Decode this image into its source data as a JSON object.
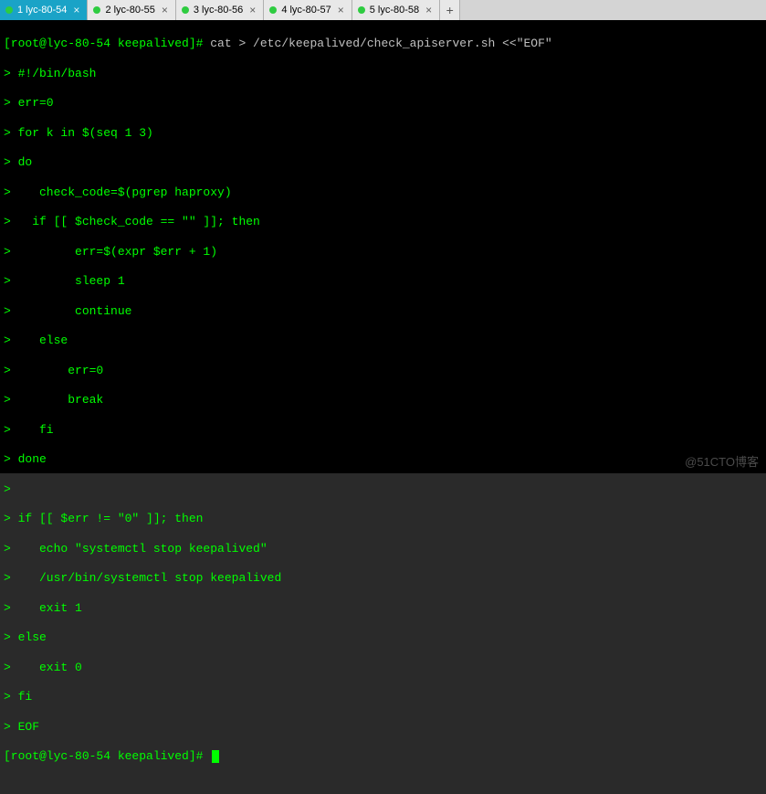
{
  "tabs": [
    {
      "label": "1 lyc-80-54",
      "active": true
    },
    {
      "label": "2 lyc-80-55",
      "active": false
    },
    {
      "label": "3 lyc-80-56",
      "active": false
    },
    {
      "label": "4 lyc-80-57",
      "active": false
    },
    {
      "label": "5 lyc-80-58",
      "active": false
    }
  ],
  "new_tab_label": "+",
  "prompt": {
    "user_host": "[root@lyc-80-54 keepalived]#",
    "command": "cat > /etc/keepalived/check_apiserver.sh <<\"EOF\""
  },
  "script_lines": [
    "> #!/bin/bash",
    "> err=0",
    "> for k in $(seq 1 3)",
    "> do",
    ">    check_code=$(pgrep haproxy)",
    ">   if [[ $check_code == \"\" ]]; then",
    ">         err=$(expr $err + 1)",
    ">         sleep 1",
    ">         continue",
    ">    else",
    ">        err=0",
    ">        break",
    ">    fi",
    "> done",
    ">",
    "> if [[ $err != \"0\" ]]; then",
    ">    echo \"systemctl stop keepalived\"",
    ">    /usr/bin/systemctl stop keepalived",
    ">    exit 1",
    "> else",
    ">    exit 0",
    "> fi",
    "> EOF"
  ],
  "prompt2": {
    "user_host": "[root@lyc-80-54 keepalived]#"
  },
  "watermark": "@51CTO博客"
}
